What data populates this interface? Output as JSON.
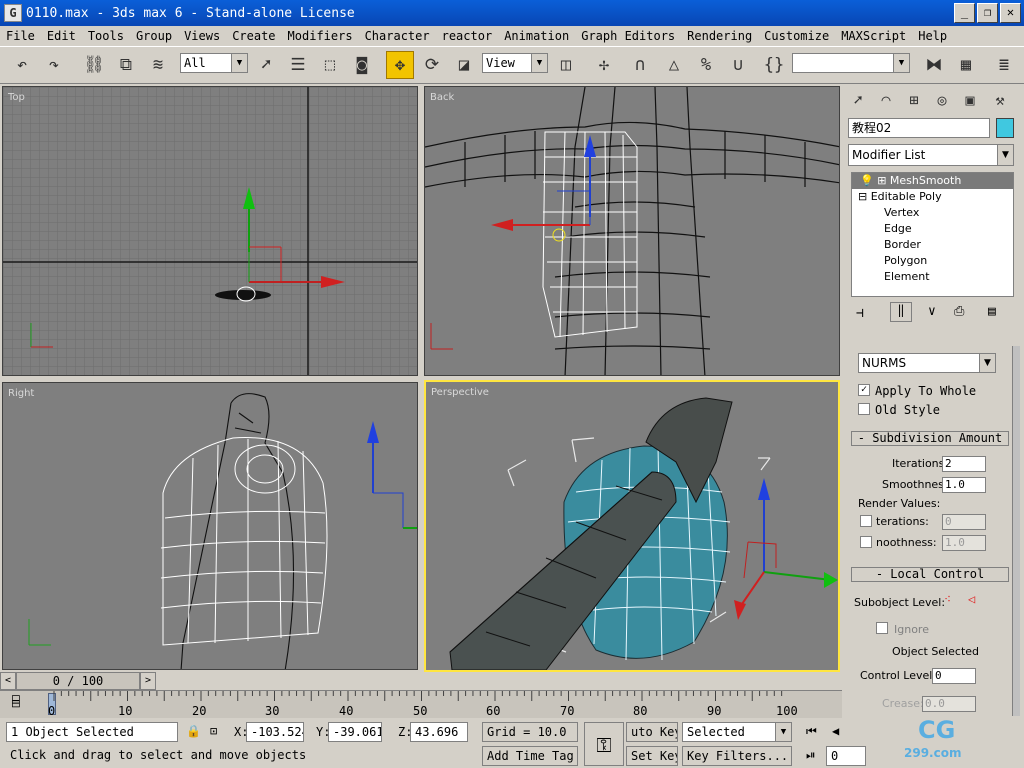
{
  "window": {
    "title": "0110.max - 3ds max 6 - Stand-alone License",
    "app_icon": "G"
  },
  "menu": [
    "File",
    "Edit",
    "Tools",
    "Group",
    "Views",
    "Create",
    "Modifiers",
    "Character",
    "reactor",
    "Animation",
    "Graph Editors",
    "Rendering",
    "Customize",
    "MAXScript",
    "Help"
  ],
  "toolbar": {
    "selection_filter": "All",
    "ref_coord": "View",
    "named_selection": ""
  },
  "viewports": {
    "top": "Top",
    "back": "Back",
    "right": "Right",
    "perspective": "Perspective"
  },
  "command_panel": {
    "object_name": "教程02",
    "object_color": "#40c8e0",
    "modifier_list": "Modifier List",
    "stack": [
      "MeshSmooth",
      "Editable Poly",
      "Vertex",
      "Edge",
      "Border",
      "Polygon",
      "Element"
    ],
    "subdivision_method": "NURMS",
    "apply_to_whole": "Apply To Whole",
    "old_style": "Old Style",
    "subdivision_amount": "- Subdivision Amount",
    "iterations_label": "Iterations:",
    "iterations_value": "2",
    "smoothness_label": "Smoothness:",
    "smoothness_value": "1.0",
    "render_values_label": "Render Values:",
    "render_iterations_label": "terations:",
    "render_iterations_value": "0",
    "render_smoothness_label": "noothness:",
    "render_smoothness_value": "1.0",
    "local_control": "- Local Control",
    "subobject_level_label": "Subobject Level:",
    "ignore_label": "Ignore",
    "object_selected": "Object Selected",
    "control_level_label": "Control Level:",
    "control_level_value": "0",
    "crease_label": "Crease:",
    "crease_value": "0.0"
  },
  "time": {
    "slider": "0 / 100",
    "ticks": [
      "0",
      "10",
      "20",
      "30",
      "40",
      "50",
      "60",
      "70",
      "80",
      "90",
      "100"
    ]
  },
  "status": {
    "selected": "1 Object Selected",
    "prompt": "Click and drag to select and move objects",
    "x_label": "X:",
    "x": "-103.524",
    "y_label": "Y:",
    "y": "-39.061",
    "z_label": "Z:",
    "z": "43.696",
    "grid": "Grid = 10.0",
    "add_time_tag": "Add Time Tag",
    "auto_key": "uto Key",
    "set_key": "Set Key",
    "key_mode": "Selected",
    "key_filters": "Key Filters...",
    "frame": "0"
  },
  "watermark": {
    "logo": "CG",
    "site": "299.com"
  }
}
